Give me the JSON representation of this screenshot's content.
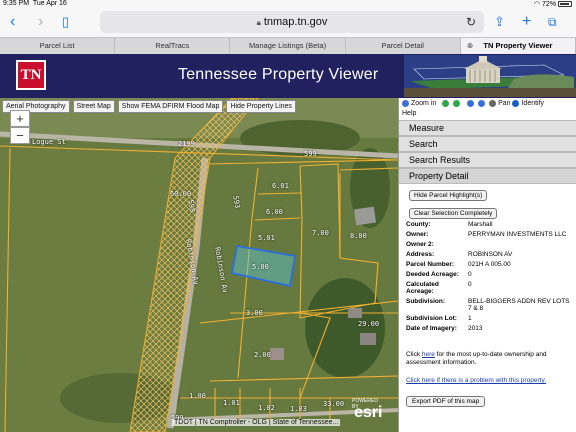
{
  "status_bar": {
    "time": "9:35 PM",
    "date": "Tue Apr 16",
    "battery": "72%"
  },
  "browser": {
    "url": "tnmap.tn.gov",
    "tabs": [
      "Parcel List",
      "RealTracs",
      "Manage Listings (Beta)",
      "Parcel Detail",
      "TN Property Viewer"
    ],
    "active_tab_index": 4
  },
  "banner": {
    "logo_text": "TN",
    "title": "Tennessee Property Viewer"
  },
  "map": {
    "buttons": [
      "Aerial Photography",
      "Street Map",
      "Show FEMA DFIRM Flood Map",
      "Hide Property Lines"
    ],
    "zoom_in": "+",
    "zoom_out": "−",
    "labels": {
      "logue_st": "Logue St",
      "n2199": "2199",
      "n599a": "599",
      "n593": "593",
      "n599b": "599",
      "n598": "598",
      "robinson_av": "Robinson Av",
      "robinson_av2": "Robinson Av",
      "p6001": "60.00",
      "p601": "6.01",
      "p600": "6.00",
      "p501": "5.01",
      "p500": "5.00",
      "p700": "7.00",
      "p800": "8.00",
      "p300": "3.00",
      "p2900": "29.00",
      "p200": "2.00",
      "p100": "1.00",
      "p101": "1.01",
      "p102": "1.02",
      "p103": "1.03",
      "p3300": "33.00"
    },
    "attribution": "TDOT | TN Comptroller - OLG | State of Tennessee...",
    "esri_credit": "POWERED BY",
    "esri": "esri"
  },
  "panel": {
    "tools": {
      "zoom_in": "Zoom in",
      "pan": "Pan",
      "identify": "Identify",
      "help": "Help"
    },
    "sections": [
      "Measure",
      "Search",
      "Search Results",
      "Property Detail"
    ],
    "buttons": {
      "hide_highlight": "Hide Parcel Highlight(s)",
      "clear_selection": "Clear Selection Completely",
      "export": "Export PDF of this map"
    },
    "details": [
      {
        "key": "County:",
        "value": "Marshall"
      },
      {
        "key": "Owner:",
        "value": "PERRYMAN INVESTMENTS LLC"
      },
      {
        "key": "Owner 2:",
        "value": ""
      },
      {
        "key": "Address:",
        "value": "ROBINSON AV"
      },
      {
        "key": "Parcel Number:",
        "value": "021H A 005.00"
      },
      {
        "key": "Deeded Acreage:",
        "value": "0"
      },
      {
        "key": "Calculated Acreage:",
        "value": "0"
      },
      {
        "key": "Subdivision:",
        "value": "BELL-BIGGERS ADDN REV LOTS 7 & 8"
      },
      {
        "key": "Subdivision Lot:",
        "value": "1"
      },
      {
        "key": "Date of Imagery:",
        "value": "2013"
      }
    ],
    "note1": {
      "prefix": "Click ",
      "link": "here",
      "suffix": " for the most up-to-date ownership and assessment information."
    },
    "note2": "Click here if there is a problem with this property."
  },
  "colors": {
    "banner": "#21215f",
    "logo_red": "#c8102e",
    "parcel_line": "#f0b030",
    "selected_parcel": "#2a6fdb",
    "link": "#1a3da8"
  }
}
